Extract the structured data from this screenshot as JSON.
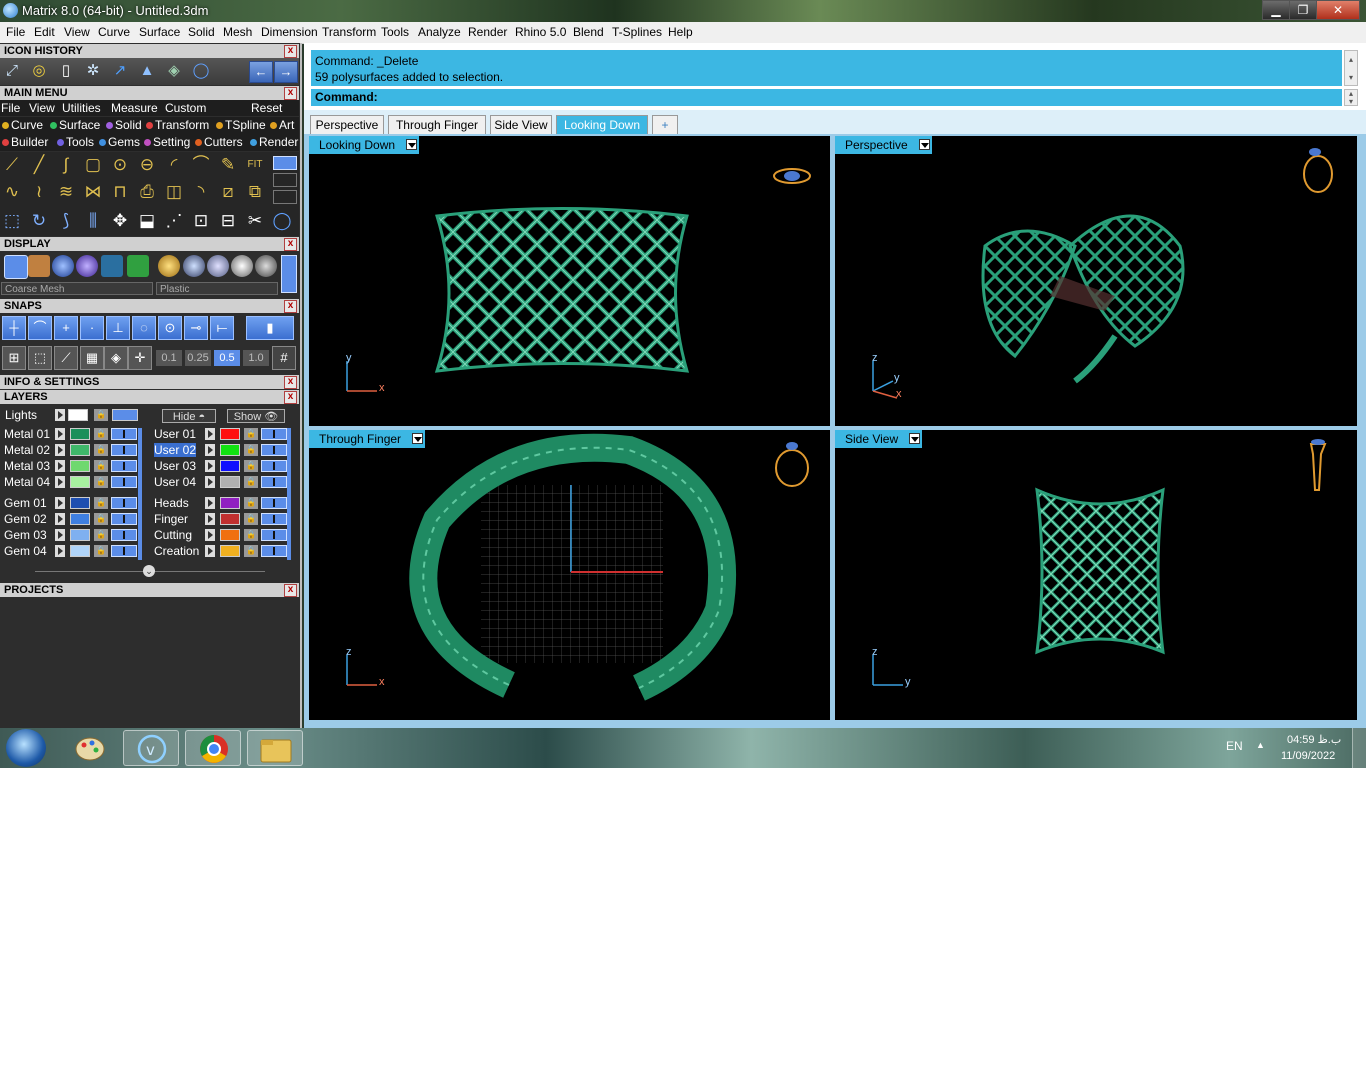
{
  "window": {
    "title": "Matrix 8.0 (64-bit) - Untitled.3dm",
    "minimize": "▁",
    "maximize": "❐",
    "close": "✕"
  },
  "menubar": [
    "File",
    "Edit",
    "View",
    "Curve",
    "Surface",
    "Solid",
    "Mesh",
    "Dimension",
    "Transform",
    "Tools",
    "Analyze",
    "Render",
    "Rhino 5.0",
    "Blend",
    "T-Splines",
    "Help"
  ],
  "panel": {
    "icon_history": "ICON HISTORY",
    "main_menu": "MAIN MENU",
    "main_menu_items": [
      "File",
      "View",
      "Utilities",
      "Measure",
      "Custom"
    ],
    "reset": "Reset",
    "categories_row1": [
      {
        "label": "Curve",
        "color": "#e0b020"
      },
      {
        "label": "Surface",
        "color": "#30c060"
      },
      {
        "label": "Solid",
        "color": "#a060e0"
      },
      {
        "label": "Transform",
        "color": "#e04040"
      },
      {
        "label": "TSpline",
        "color": "#e0a020"
      },
      {
        "label": "Art",
        "color": "#e0a020"
      }
    ],
    "categories_row2": [
      {
        "label": "Builder",
        "color": "#e04040"
      },
      {
        "label": "Tools",
        "color": "#7060e0"
      },
      {
        "label": "Gems",
        "color": "#4090e0"
      },
      {
        "label": "Setting",
        "color": "#c050c0"
      },
      {
        "label": "Cutters",
        "color": "#e06020"
      },
      {
        "label": "Render",
        "color": "#40a0e0"
      }
    ],
    "display": "DISPLAY",
    "display_mesh": "Coarse Mesh",
    "display_material": "Plastic",
    "snaps": "SNAPS",
    "snap_values": [
      "0.1",
      "0.25",
      "0.5",
      "1.0"
    ],
    "info_settings": "INFO & SETTINGS",
    "layers": "LAYERS",
    "lights": "Lights",
    "hide": "Hide",
    "show": "Show",
    "layers_left": [
      {
        "name": "Metal 01",
        "color": "#1a8f5a"
      },
      {
        "name": "Metal 02",
        "color": "#3fb86a"
      },
      {
        "name": "Metal 03",
        "color": "#6fd86f"
      },
      {
        "name": "Metal 04",
        "color": "#a8f0a0"
      },
      {
        "name": "Gem 01",
        "color": "#1f4fb0"
      },
      {
        "name": "Gem 02",
        "color": "#3f7fe0"
      },
      {
        "name": "Gem 03",
        "color": "#7fb0f0"
      },
      {
        "name": "Gem 04",
        "color": "#b0d4f8"
      }
    ],
    "layers_right": [
      {
        "name": "User 01",
        "color": "#ff1010"
      },
      {
        "name": "User 02",
        "color": "#10e010"
      },
      {
        "name": "User 03",
        "color": "#1010ff"
      },
      {
        "name": "User 04",
        "color": "#b0b0b0"
      },
      {
        "name": "Heads",
        "color": "#9020c0"
      },
      {
        "name": "Finger",
        "color": "#c03030"
      },
      {
        "name": "Cutting",
        "color": "#f07010"
      },
      {
        "name": "Creation",
        "color": "#f0b020"
      }
    ],
    "projects": "PROJECTS"
  },
  "command": {
    "line1": "Command: _Delete",
    "line2": "59 polysurfaces added to selection.",
    "prompt": "Command:"
  },
  "tabs": [
    "Perspective",
    "Through Finger",
    "Side View",
    "Looking Down"
  ],
  "add_tab": "+",
  "viewports": {
    "top_left": {
      "label": "Looking Down",
      "ax1": "y",
      "ax2": "x"
    },
    "top_right": {
      "label": "Perspective",
      "ax1": "z",
      "ax2": "y",
      "ax3": "x"
    },
    "bottom_left": {
      "label": "Through Finger",
      "ax1": "z",
      "ax2": "x"
    },
    "bottom_right": {
      "label": "Side View",
      "ax1": "z",
      "ax2": "y"
    }
  },
  "taskbar": {
    "lang": "EN",
    "tray_arrow": "▲",
    "time": "04:59 ب.ظ",
    "date": "11/09/2022"
  }
}
